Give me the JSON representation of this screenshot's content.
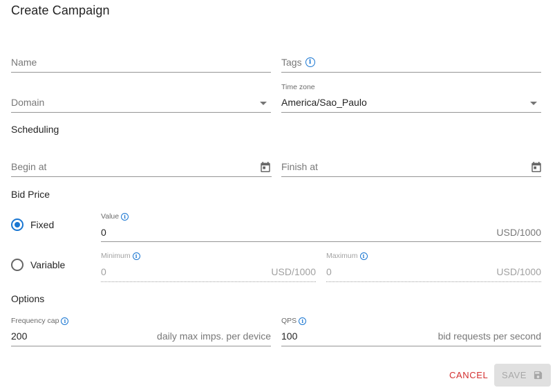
{
  "dialog": {
    "title": "Create Campaign"
  },
  "fields": {
    "name": {
      "label": "Name"
    },
    "tags": {
      "label": "Tags"
    },
    "domain": {
      "label": "Domain"
    },
    "timezone": {
      "label": "Time zone",
      "value": "America/Sao_Paulo"
    }
  },
  "scheduling": {
    "title": "Scheduling",
    "begin_label": "Begin at",
    "finish_label": "Finish at"
  },
  "bid_price": {
    "title": "Bid Price",
    "fixed_label": "Fixed",
    "variable_label": "Variable",
    "selected": "Fixed",
    "value_label": "Value",
    "value": "0",
    "value_suffix": "USD/1000",
    "minimum_label": "Minimum",
    "minimum_value": "0",
    "minimum_suffix": "USD/1000",
    "maximum_label": "Maximum",
    "maximum_value": "0",
    "maximum_suffix": "USD/1000"
  },
  "options": {
    "title": "Options",
    "frequency_cap_label": "Frequency cap",
    "frequency_cap_value": "200",
    "frequency_cap_suffix": "daily max imps. per device",
    "qps_label": "QPS",
    "qps_value": "100",
    "qps_suffix": "bid requests per second"
  },
  "actions": {
    "cancel_label": "CANCEL",
    "save_label": "SAVE",
    "save_enabled": false
  },
  "colors": {
    "accent": "#1976d2",
    "cancel": "#d32f2f",
    "disabled_button_bg": "#e0e0e0"
  },
  "icons": {
    "info": "info-circle-icon",
    "calendar": "calendar-icon",
    "dropdown": "caret-down-icon",
    "save": "floppy-disk-icon"
  }
}
